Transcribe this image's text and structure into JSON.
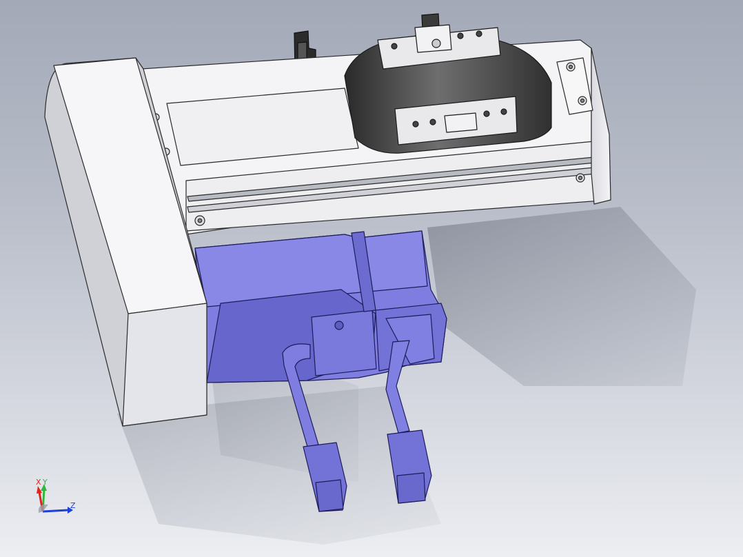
{
  "viewport": {
    "background_top": "#a3a9b7",
    "background_bottom": "#eceef2"
  },
  "model": {
    "body_color": "#f1f1f3",
    "motor_color": "#7f7ee0",
    "motor_dark": "#5f5fc4",
    "grip_color": "#4b4b4b",
    "edge_color": "#2a2a2a"
  },
  "triad": {
    "x_label": "X",
    "y_label": "Y",
    "z_label": "Z",
    "x_color": "#e0241f",
    "y_color": "#2fb83b",
    "z_color": "#1f3fd6"
  }
}
